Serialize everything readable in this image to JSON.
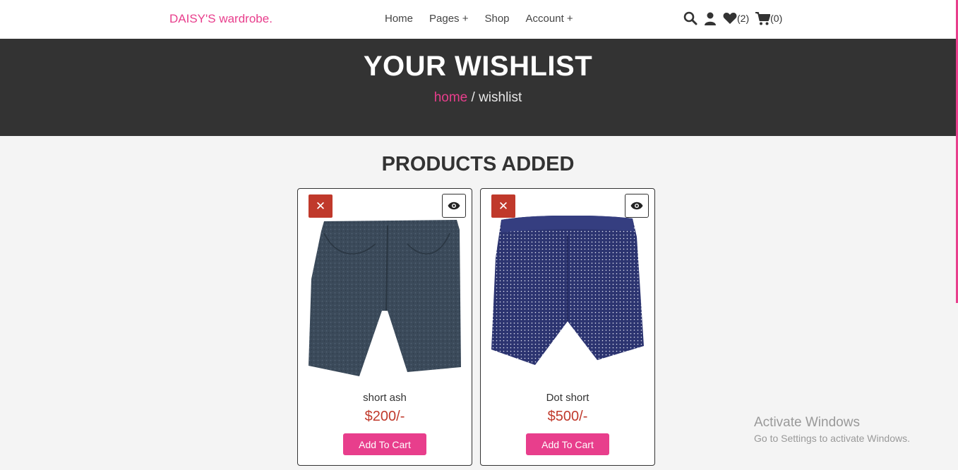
{
  "header": {
    "logo": "DAISY'S wardrobe.",
    "nav": [
      "Home",
      "Pages +",
      "Shop",
      "Account +"
    ],
    "icons": {
      "search": "search-icon",
      "user": "user-icon",
      "wishlist": "heart-icon",
      "cart": "cart-icon"
    },
    "wishlist_count": "(2)",
    "cart_count": "(0)"
  },
  "hero": {
    "title": "YOUR WISHLIST",
    "breadcrumb_home": "home",
    "breadcrumb_sep": " / ",
    "breadcrumb_current": "wishlist"
  },
  "section_title": "PRODUCTS ADDED",
  "products": [
    {
      "name": "short ash",
      "price": "$200/-",
      "button": "Add To Cart",
      "remove": "✕"
    },
    {
      "name": "Dot short",
      "price": "$500/-",
      "button": "Add To Cart",
      "remove": "✕"
    }
  ],
  "watermark": {
    "title": "Activate Windows",
    "subtitle": "Go to Settings to activate Windows."
  },
  "colors": {
    "accent": "#e83e8c",
    "hero_bg": "#333333",
    "price": "#c0392b",
    "remove": "#c0392b"
  }
}
